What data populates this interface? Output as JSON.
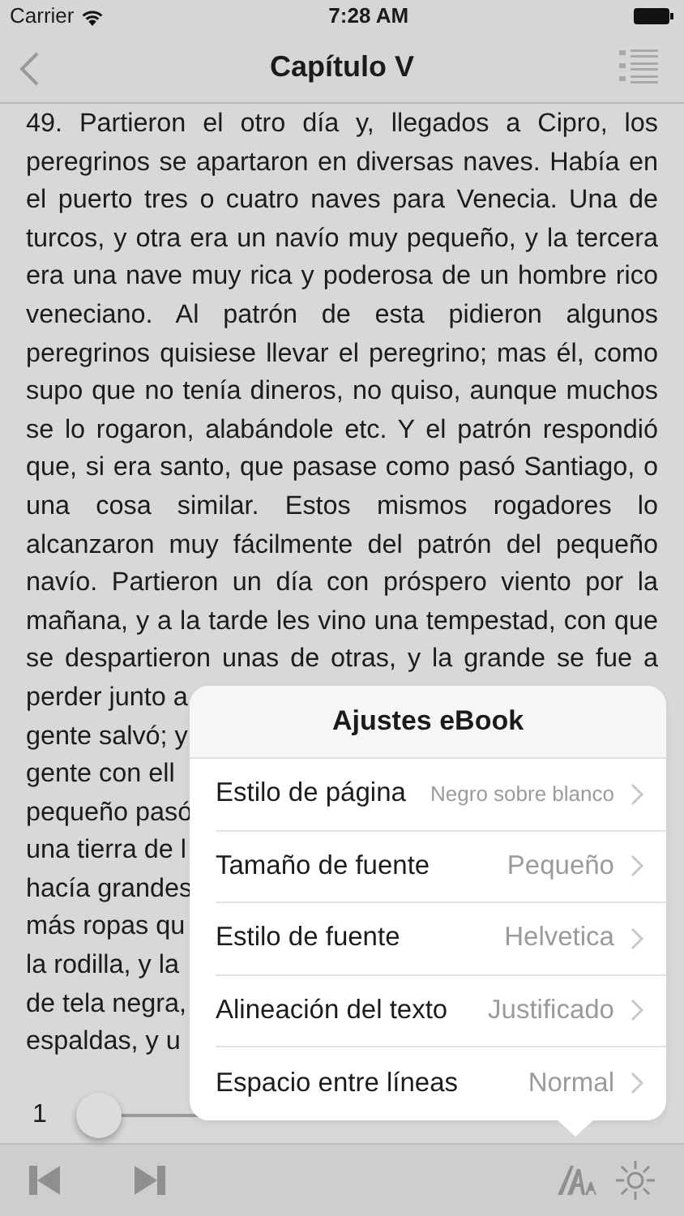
{
  "status_bar": {
    "carrier": "Carrier",
    "time": "7:28 AM"
  },
  "nav_bar": {
    "title": "Capítulo V"
  },
  "text_lines": [
    {
      "text": "49. Partieron el otro día y, llegados a Cipro, los",
      "kind": "full"
    },
    {
      "text": "peregrinos se apartaron en diversas naves. Había en",
      "kind": "full"
    },
    {
      "text": "el puerto tres o cuatro naves para Venecia. Una de",
      "kind": "full"
    },
    {
      "text": "turcos, y otra era un navío muy pequeño, y la tercera",
      "kind": "full"
    },
    {
      "text": "era una nave muy rica y poderosa de un hombre rico",
      "kind": "full"
    },
    {
      "text": "veneciano. Al patrón de esta pidieron algunos",
      "kind": "full"
    },
    {
      "text": "peregrinos quisiese llevar el peregrino; mas él, como",
      "kind": "full"
    },
    {
      "text": "supo que no tenía dineros, no quiso, aunque muchos",
      "kind": "full"
    },
    {
      "text": "se lo rogaron, alabándole etc. Y el patrón respondió",
      "kind": "full"
    },
    {
      "text": "que, si era santo, que pasase como pasó Santiago, o",
      "kind": "full"
    },
    {
      "text": "una cosa similar. Estos mismos rogadores lo",
      "kind": "full"
    },
    {
      "text": "alcanzaron muy fácilmente del patrón del pequeño",
      "kind": "full"
    },
    {
      "text": "navío. Partieron un día con próspero viento por la",
      "kind": "full"
    },
    {
      "text": "mañana, y a la tarde les vino una tempestad, con que",
      "kind": "full"
    },
    {
      "text": "se despartieron unas de otras, y la grande se fue a",
      "kind": "full"
    },
    {
      "text": "perder junto a",
      "kind": "cut"
    },
    {
      "text": "gente salvó; y",
      "kind": "cut"
    },
    {
      "text": "gente con ell",
      "kind": "cut"
    },
    {
      "text": "pequeño pasó",
      "kind": "cut"
    },
    {
      "text": "una tierra de l",
      "kind": "cut"
    },
    {
      "text": "hacía grandes",
      "kind": "cut"
    },
    {
      "text": "más ropas qu",
      "kind": "cut"
    },
    {
      "text": "la rodilla, y la",
      "kind": "cut"
    },
    {
      "text": "de tela negra,",
      "kind": "cut"
    },
    {
      "text": "espaldas, y u",
      "kind": "cut"
    }
  ],
  "page_slider": {
    "page": "1",
    "level": 0
  },
  "settings_popover": {
    "title": "Ajustes eBook",
    "rows": [
      {
        "label": "Estilo de página",
        "value": "Negro sobre blanco",
        "kind": "small"
      },
      {
        "label": "Tamaño de fuente",
        "value": "Pequeño",
        "kind": "normal"
      },
      {
        "label": "Estilo de fuente",
        "value": "Helvetica",
        "kind": "normal"
      },
      {
        "label": "Alineación del texto",
        "value": "Justificado",
        "kind": "normal"
      },
      {
        "label": "Espacio entre líneas",
        "value": "Normal",
        "kind": "normal"
      }
    ]
  }
}
